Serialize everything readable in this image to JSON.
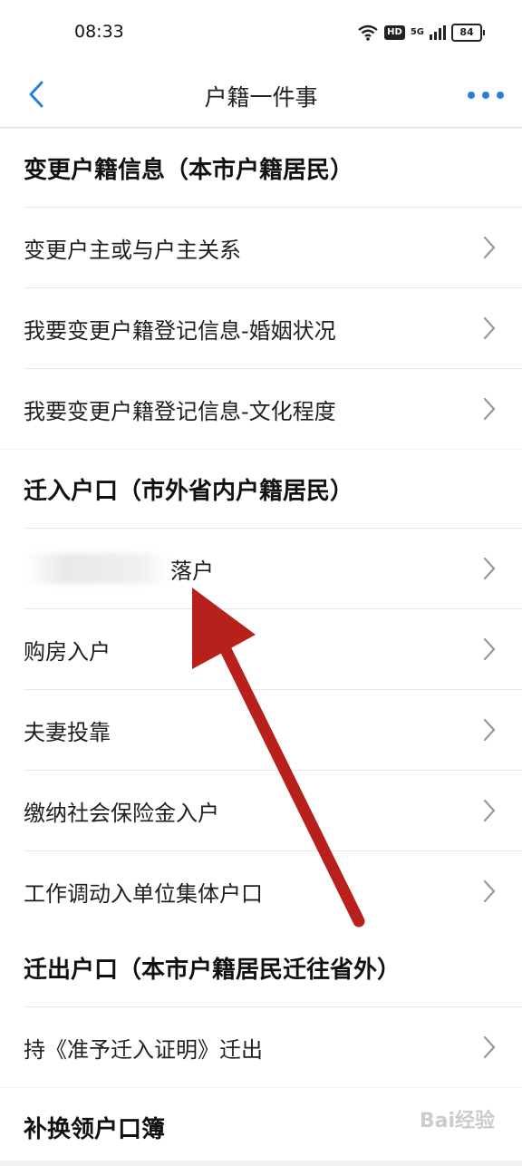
{
  "status_bar": {
    "time": "08:33",
    "hd_label": "HD",
    "network_label": "5G",
    "battery": "84"
  },
  "nav": {
    "title": "户籍一件事",
    "back_icon": "chevron-left-icon",
    "more_icon": "more-dots-icon"
  },
  "sections": [
    {
      "header": "变更户籍信息（本市户籍居民）",
      "items": [
        "变更户主或与户主关系",
        "我要变更户籍登记信息-婚姻状况",
        "我要变更户籍登记信息-文化程度"
      ]
    },
    {
      "header": "迁入户口（市外省内户籍居民）",
      "items": [
        "落户",
        "购房入户",
        "夫妻投靠",
        "缴纳社会保险金入户",
        "工作调动入单位集体户口"
      ]
    },
    {
      "header": "迁出户口（本市户籍居民迁往省外）",
      "items": [
        "持《准予迁入证明》迁出"
      ]
    },
    {
      "header": "补换领户口簿",
      "items": []
    }
  ],
  "watermark": "Bai经验",
  "colors": {
    "accent": "#2b7fd6",
    "annotation_arrow": "#b8211b",
    "background": "#f2f2f2"
  }
}
